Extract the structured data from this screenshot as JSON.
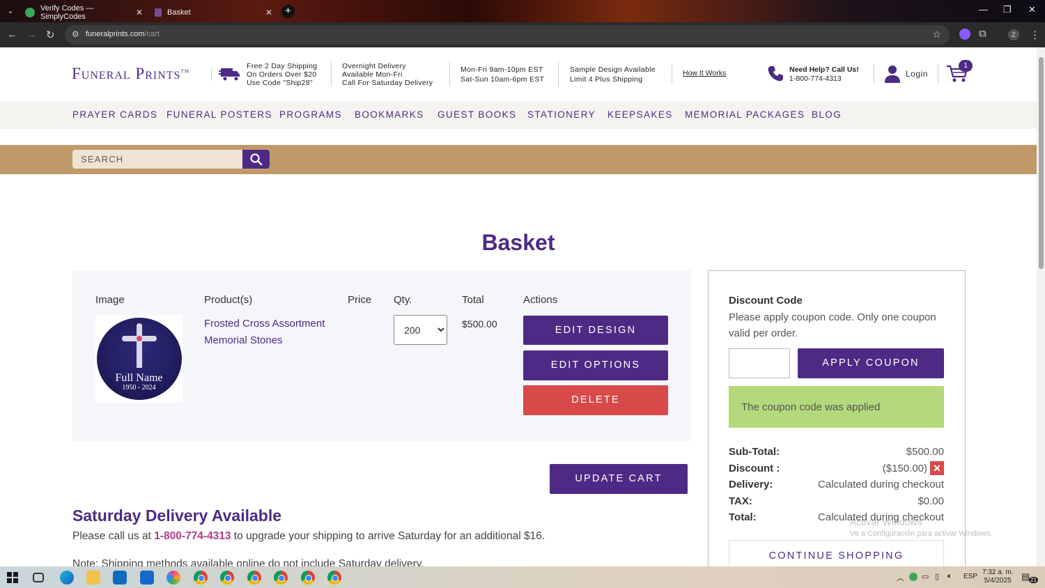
{
  "browser": {
    "tabs": [
      {
        "title": "Verify Codes — SimplyCodes"
      },
      {
        "title": "Basket"
      }
    ],
    "url_host": "funeralprints.com",
    "url_path": "/cart"
  },
  "header": {
    "logo": "Funeral Prints",
    "logo_tm": "TM",
    "shipping_info": [
      "Free 2 Day Shipping",
      "On Orders Over $20",
      "Use Code \"Ship28\""
    ],
    "overnight_info": [
      "Overnight Delivery",
      "Available Mon-Fri",
      "Call For Saturday Delivery"
    ],
    "hours_info": [
      "Mon-Fri 9am-10pm EST",
      "Sat-Sun 10am-6pm EST"
    ],
    "sample_info": [
      "Sample Design Available",
      "Limit 4 Plus Shipping"
    ],
    "how_it_works": "How It Works",
    "help_label": "Need Help? Call Us!",
    "help_phone": "1-800-774-4313",
    "login": "Login",
    "cart_count": "1"
  },
  "nav": [
    "PRAYER CARDS",
    "FUNERAL POSTERS",
    "PROGRAMS",
    "BOOKMARKS",
    "GUEST BOOKS",
    "STATIONERY",
    "KEEPSAKES",
    "MEMORIAL PACKAGES",
    "BLOG"
  ],
  "search": {
    "placeholder": "SEARCH"
  },
  "basket": {
    "title": "Basket",
    "columns": [
      "Image",
      "Product(s)",
      "Price",
      "Qty.",
      "Total",
      "Actions"
    ],
    "item": {
      "image_name": "Full Name",
      "image_dates": "1950 - 2024",
      "product": "Frosted Cross Assortment Memorial Stones",
      "price": "",
      "qty": "200",
      "total": "$500.00"
    },
    "actions": {
      "edit_design": "EDIT DESIGN",
      "edit_options": "EDIT OPTIONS",
      "delete": "DELETE"
    },
    "update_cart": "UPDATE CART"
  },
  "saturday": {
    "title": "Saturday Delivery Available",
    "text_before": "Please call us at ",
    "phone": "1-800-774-4313",
    "text_after": " to upgrade your shipping to arrive Saturday for an additional $16.",
    "note": "Note: Shipping methods available online do not include Saturday delivery."
  },
  "summary": {
    "discount_title": "Discount Code",
    "discount_help": "Please apply coupon code. Only one coupon valid per order.",
    "coupon_value": "",
    "apply_label": "APPLY COUPON",
    "applied_message": "The coupon code was applied",
    "rows": [
      {
        "label": "Sub-Total:",
        "value": "$500.00"
      },
      {
        "label": "Discount :",
        "value": "($150.00)"
      },
      {
        "label": "Delivery:",
        "value": "Calculated during checkout"
      },
      {
        "label": "TAX:",
        "value": "$0.00"
      },
      {
        "label": "Total:",
        "value": "Calculated during checkout"
      }
    ],
    "continue_label": "CONTINUE SHOPPING"
  },
  "watermark": {
    "line1": "Activar Windows",
    "line2": "Ve a Configuración para activar Windows."
  },
  "taskbar": {
    "lang": "ESP",
    "time": "7:32 a. m.",
    "date": "5/4/2025",
    "notif_count": "21"
  },
  "colors": {
    "brand_purple": "#4e2a84",
    "delete_red": "#d84a4a",
    "applied_green": "#b3d97c",
    "search_band": "#c0996a"
  }
}
